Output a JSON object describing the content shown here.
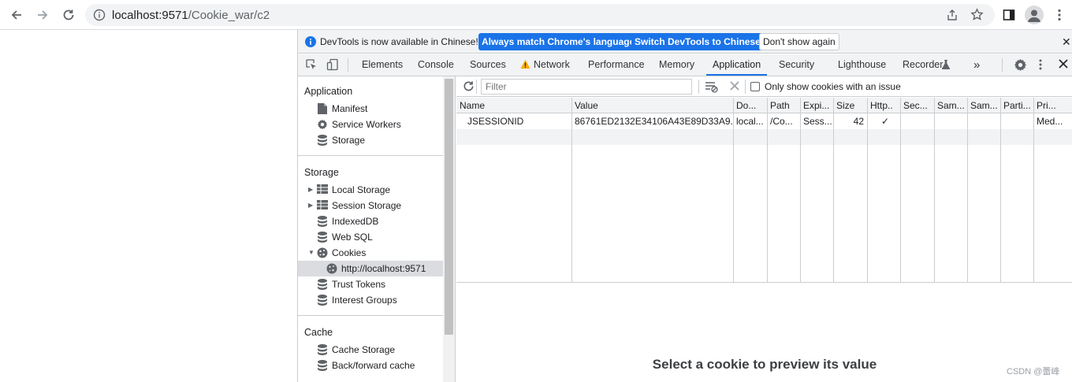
{
  "browser": {
    "url_host": "localhost:9571",
    "url_path": "/Cookie_war/c2",
    "back_icon": "back-arrow-icon",
    "forward_icon": "forward-arrow-icon",
    "reload_icon": "reload-icon"
  },
  "infobar": {
    "message": "DevTools is now available in Chinese!",
    "btn_match": "Always match Chrome's language",
    "btn_switch": "Switch DevTools to Chinese",
    "btn_dont_show": "Don't show again",
    "close": "✕"
  },
  "tabs": {
    "elements": "Elements",
    "console": "Console",
    "sources": "Sources",
    "network": "Network",
    "performance": "Performance",
    "memory": "Memory",
    "application": "Application",
    "security": "Security",
    "lighthouse": "Lighthouse",
    "recorder": "Recorder",
    "more": "»"
  },
  "sidebar": {
    "application_title": "Application",
    "manifest": "Manifest",
    "service_workers": "Service Workers",
    "storage_item": "Storage",
    "storage_title": "Storage",
    "local_storage": "Local Storage",
    "session_storage": "Session Storage",
    "indexeddb": "IndexedDB",
    "web_sql": "Web SQL",
    "cookies": "Cookies",
    "cookie_origin": "http://localhost:9571",
    "trust_tokens": "Trust Tokens",
    "interest_groups": "Interest Groups",
    "cache_title": "Cache",
    "cache_storage": "Cache Storage",
    "bfcache": "Back/forward cache"
  },
  "filter": {
    "placeholder": "Filter",
    "only_issue_label": "Only show cookies with an issue"
  },
  "table": {
    "headers": [
      "Name",
      "Value",
      "Do...",
      "Path",
      "Expi...",
      "Size",
      "Http..",
      "Sec...",
      "Sam...",
      "Sam...",
      "Parti...",
      "Pri..."
    ],
    "row": {
      "name": "JSESSIONID",
      "value": "86761ED2132E34106A43E89D33A9...",
      "domain": "local...",
      "path": "/Co...",
      "expires": "Sess...",
      "size": "42",
      "httponly": "✓",
      "priority": "Med..."
    }
  },
  "preview_text": "Select a cookie to preview its value",
  "watermark": "CSDN @蕾峰",
  "colors": {
    "accent": "#1a73e8",
    "border": "#cbcdd1",
    "panel_bg": "#f1f3f4",
    "warning": "#f9ab00"
  }
}
